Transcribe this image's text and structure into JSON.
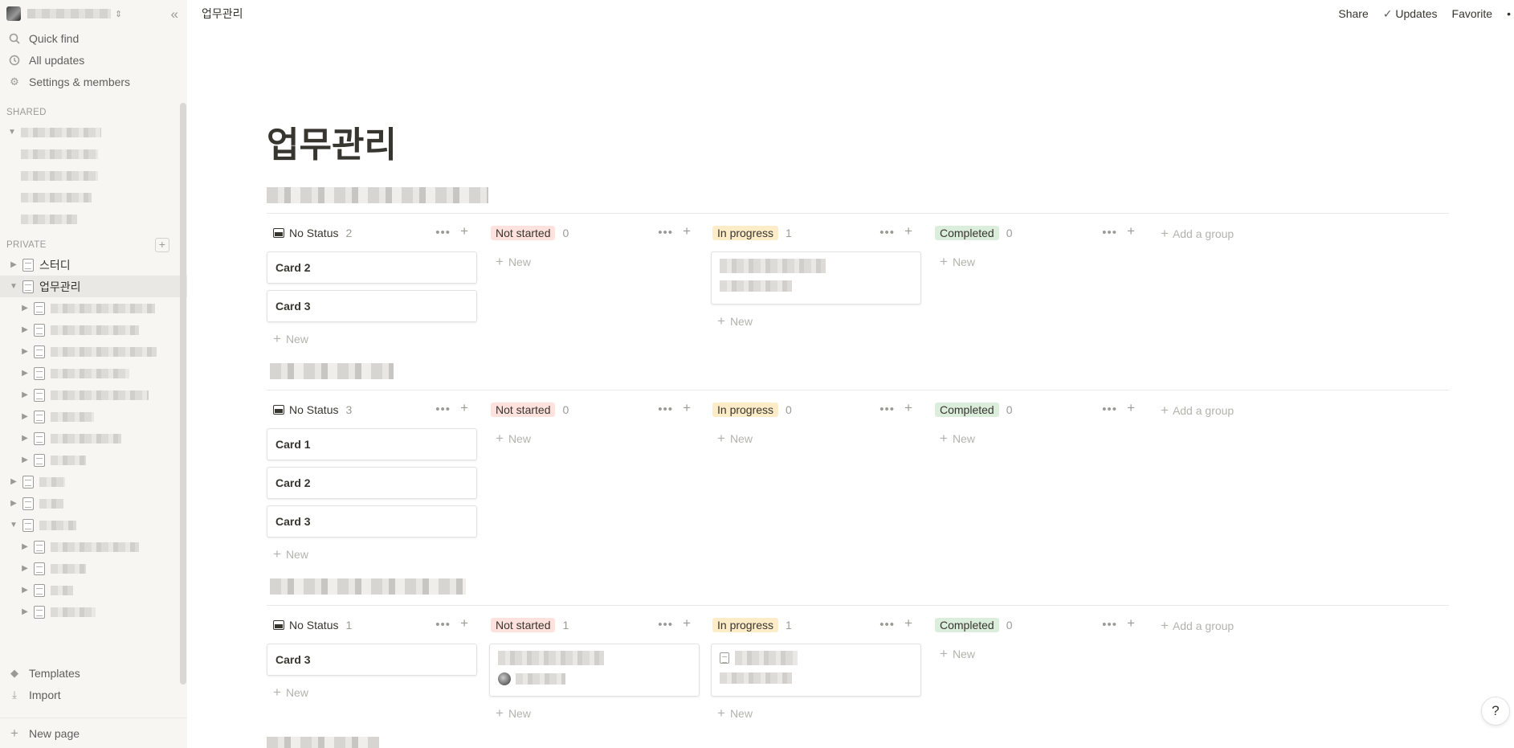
{
  "sidebar": {
    "nav": [
      {
        "label": "Quick find",
        "icon": "search-icon"
      },
      {
        "label": "All updates",
        "icon": "clock-icon"
      },
      {
        "label": "Settings & members",
        "icon": "gear-icon"
      }
    ],
    "shared_label": "SHARED",
    "private_label": "PRIVATE",
    "study_label": "스터디",
    "work_label": "업무관리",
    "templates_label": "Templates",
    "import_label": "Import",
    "new_page_label": "New page"
  },
  "topbar": {
    "breadcrumb": "업무관리",
    "share": "Share",
    "updates": "Updates",
    "favorite": "Favorite"
  },
  "page": {
    "title": "업무관리",
    "add_group": "Add a group",
    "new_label": "New"
  },
  "boards": [
    {
      "columns": [
        {
          "label": "No Status",
          "count": "2",
          "cards": [
            "Card 2",
            "Card 3"
          ]
        },
        {
          "label": "Not started",
          "count": "0",
          "cards": []
        },
        {
          "label": "In progress",
          "count": "1",
          "cards": []
        },
        {
          "label": "Completed",
          "count": "0",
          "cards": []
        }
      ]
    },
    {
      "columns": [
        {
          "label": "No Status",
          "count": "3",
          "cards": [
            "Card 1",
            "Card 2",
            "Card 3"
          ]
        },
        {
          "label": "Not started",
          "count": "0",
          "cards": []
        },
        {
          "label": "In progress",
          "count": "0",
          "cards": []
        },
        {
          "label": "Completed",
          "count": "0",
          "cards": []
        }
      ]
    },
    {
      "columns": [
        {
          "label": "No Status",
          "count": "1",
          "cards": [
            "Card 3"
          ]
        },
        {
          "label": "Not started",
          "count": "1",
          "cards": []
        },
        {
          "label": "In progress",
          "count": "1",
          "cards": []
        },
        {
          "label": "Completed",
          "count": "0",
          "cards": []
        }
      ]
    }
  ],
  "colors": {
    "not_started_bg": "#ffe2dd",
    "in_progress_bg": "#fdecc8",
    "completed_bg": "#dbeddb",
    "sidebar_bg": "#f7f6f3"
  },
  "help": "?"
}
